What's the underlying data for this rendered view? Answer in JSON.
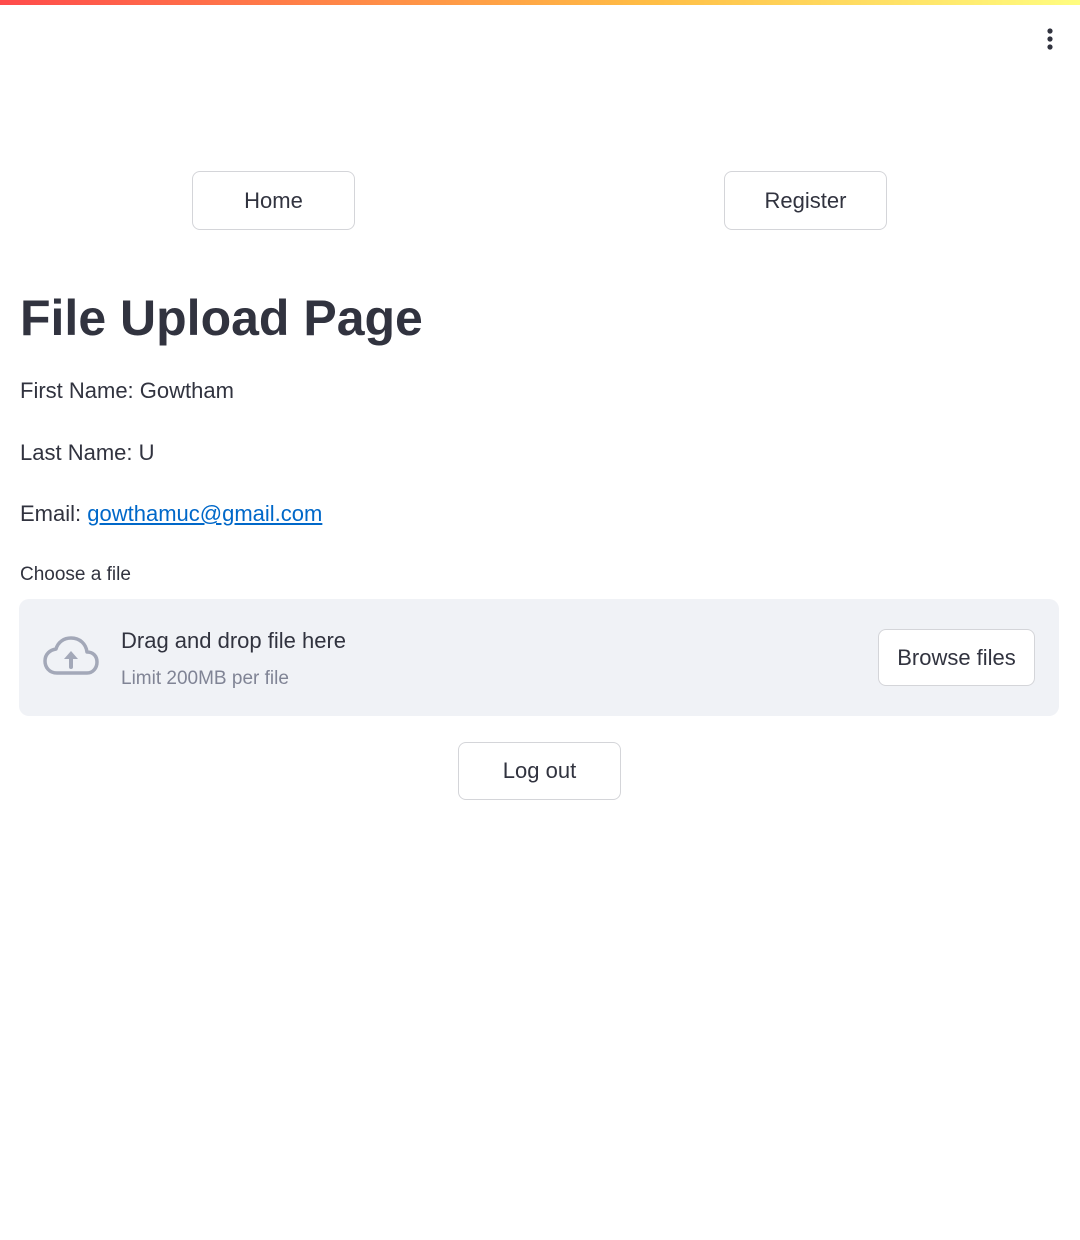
{
  "nav": {
    "home_label": "Home",
    "register_label": "Register"
  },
  "page": {
    "title": "File Upload Page"
  },
  "user": {
    "first_name_label": "First Name: ",
    "first_name": "Gowtham",
    "last_name_label": "Last Name: ",
    "last_name": "U",
    "email_label": "Email: ",
    "email": "gowthamuc@gmail.com"
  },
  "uploader": {
    "label": "Choose a file",
    "drop_title": "Drag and drop file here",
    "limit": "Limit 200MB per file",
    "browse_label": "Browse files",
    "icon": "cloud-upload-icon"
  },
  "actions": {
    "logout_label": "Log out"
  },
  "theme": {
    "accent": "#ff4b4b",
    "link": "#0068c9",
    "text": "#31333f",
    "dropzone_bg": "#f0f2f6"
  }
}
